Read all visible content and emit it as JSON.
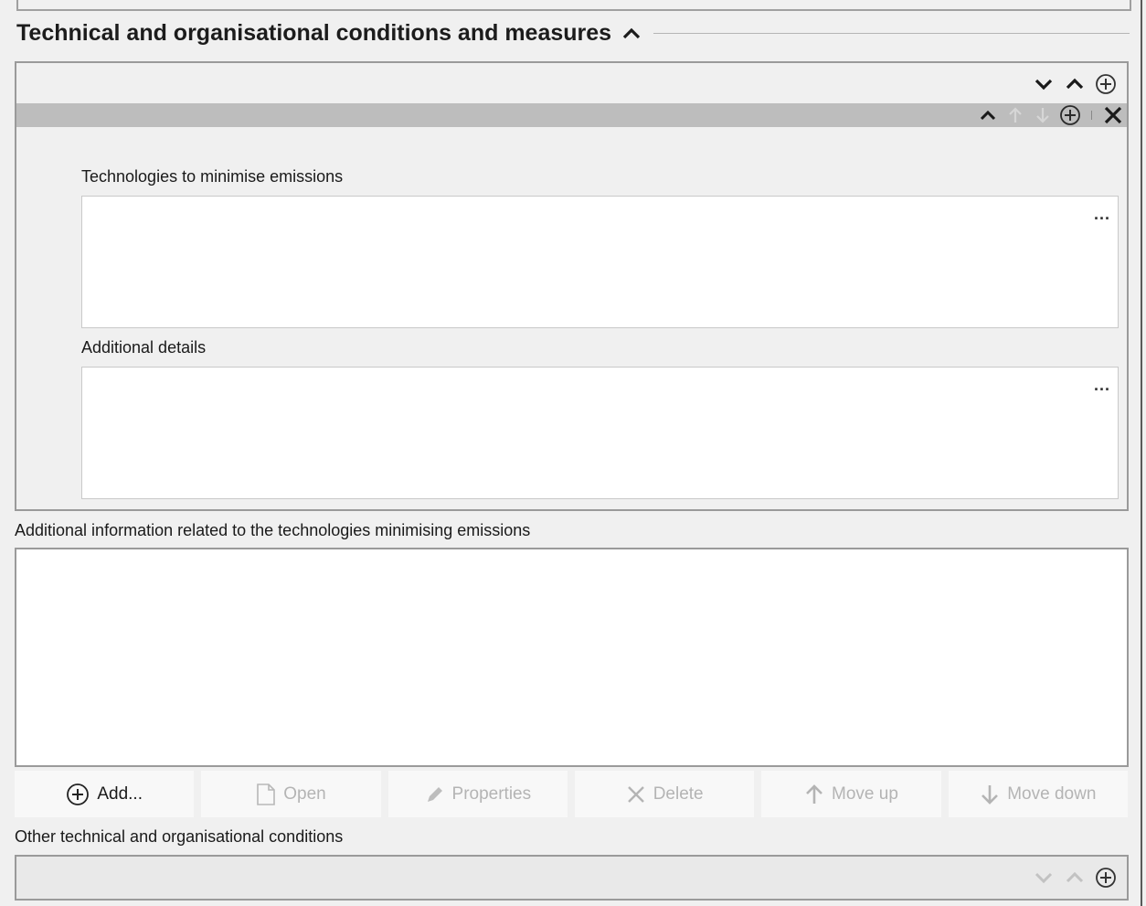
{
  "section": {
    "title": "Technical and organisational conditions and measures",
    "collapse_icon": "chevron-up-icon"
  },
  "repeat_block": {
    "toolbar_icons": [
      "chevron-down-icon",
      "chevron-up-icon",
      "plus-circle-icon"
    ],
    "entry_toolbar_icons": [
      "chevron-up-icon",
      "arrow-up-icon",
      "arrow-down-icon",
      "plus-circle-icon",
      "close-icon"
    ],
    "fields": [
      {
        "label": "Technologies to minimise emissions",
        "value": "",
        "more": "..."
      },
      {
        "label": "Additional details",
        "value": "",
        "more": "..."
      }
    ]
  },
  "additional_info": {
    "label": "Additional information related to the technologies minimising emissions",
    "value": ""
  },
  "attachment_buttons": [
    {
      "label": "Add...",
      "icon": "plus-circle-icon",
      "enabled": true
    },
    {
      "label": "Open",
      "icon": "document-icon",
      "enabled": false
    },
    {
      "label": "Properties",
      "icon": "pencil-icon",
      "enabled": false
    },
    {
      "label": "Delete",
      "icon": "close-icon",
      "enabled": false
    },
    {
      "label": "Move up",
      "icon": "arrow-up-icon",
      "enabled": false
    },
    {
      "label": "Move down",
      "icon": "arrow-down-icon",
      "enabled": false
    }
  ],
  "other_conditions": {
    "label": "Other technical and organisational conditions",
    "toolbar_icons": [
      "chevron-down-icon",
      "chevron-up-icon",
      "plus-circle-icon"
    ]
  }
}
